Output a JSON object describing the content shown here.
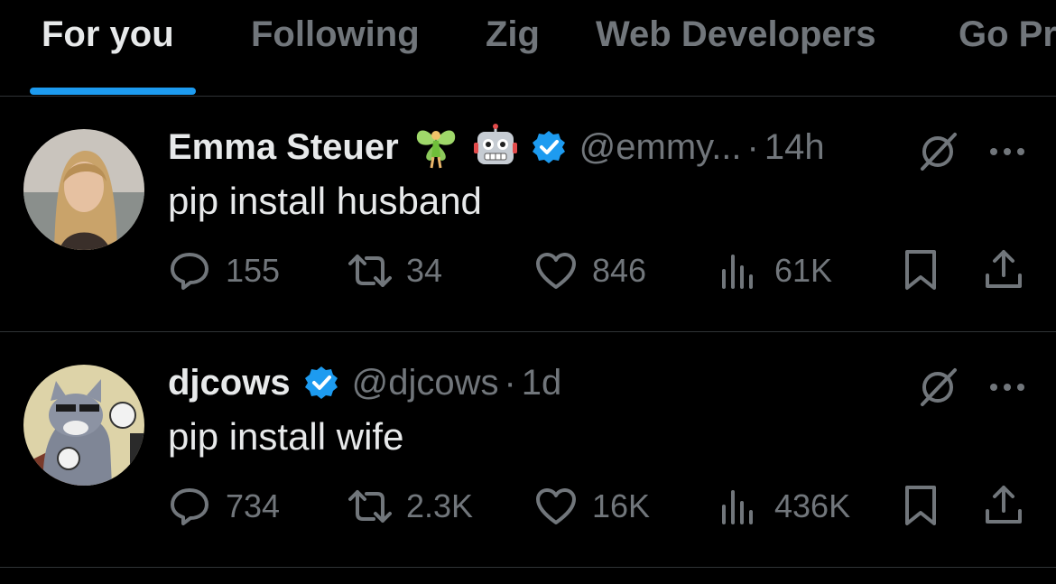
{
  "tabs": [
    {
      "label": "For you",
      "active": true
    },
    {
      "label": "Following",
      "active": false
    },
    {
      "label": "Zig",
      "active": false
    },
    {
      "label": "Web Developers",
      "active": false
    },
    {
      "label": "Go Pr",
      "active": false
    }
  ],
  "colors": {
    "accent": "#1d9bf0",
    "muted": "#71767b",
    "text": "#e7e9ea",
    "divider": "#2f3336",
    "background": "#000000"
  },
  "tweets": [
    {
      "name": "Emma Steuer",
      "name_emojis": [
        "fairy-emoji",
        "robot-emoji"
      ],
      "verified": true,
      "handle": "@emmy...",
      "separator": "·",
      "time": "14h",
      "text": "pip install husband",
      "replies": "155",
      "reposts": "34",
      "likes": "846",
      "views": "61K"
    },
    {
      "name": "djcows",
      "name_emojis": [],
      "verified": true,
      "handle": "@djcows",
      "separator": "·",
      "time": "1d",
      "text": "pip install wife",
      "replies": "734",
      "reposts": "2.3K",
      "likes": "16K",
      "views": "436K"
    }
  ]
}
